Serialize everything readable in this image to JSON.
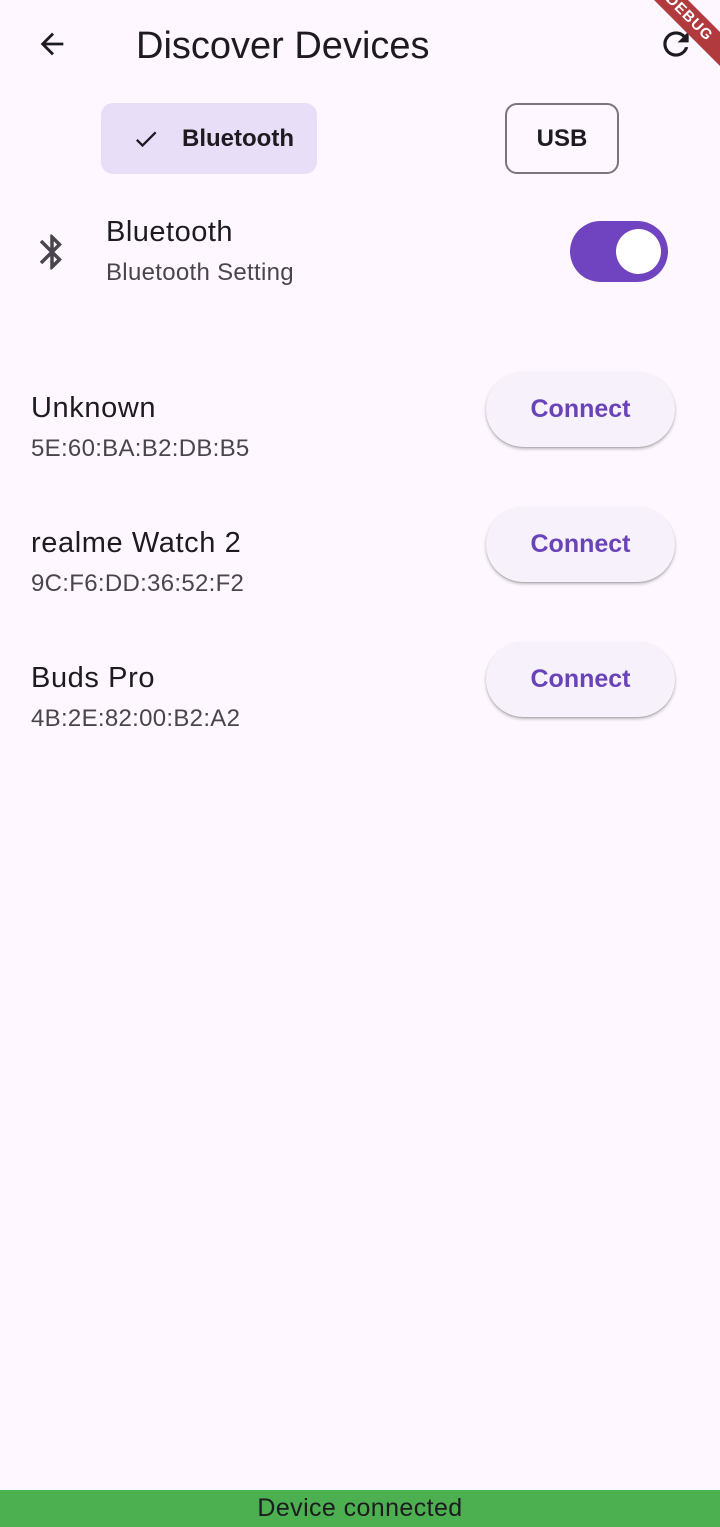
{
  "header": {
    "title": "Discover Devices",
    "back_icon": "arrow-back-icon",
    "refresh_icon": "refresh-icon"
  },
  "debug_banner": "DEBUG",
  "mode_chips": [
    {
      "label": "Bluetooth",
      "selected": true,
      "icon": "check-icon"
    },
    {
      "label": "USB",
      "selected": false
    }
  ],
  "bluetooth_setting": {
    "icon": "bluetooth-icon",
    "title": "Bluetooth",
    "subtitle": "Bluetooth Setting",
    "enabled": true
  },
  "devices": [
    {
      "name": "Unknown",
      "mac": "5E:60:BA:B2:DB:B5",
      "action": "Connect"
    },
    {
      "name": "realme Watch 2",
      "mac": "9C:F6:DD:36:52:F2",
      "action": "Connect"
    },
    {
      "name": "Buds Pro",
      "mac": "4B:2E:82:00:B2:A2",
      "action": "Connect"
    }
  ],
  "status": {
    "message": "Device connected",
    "color": "#4caf50"
  },
  "colors": {
    "accent": "#7043c0",
    "chip_selected_bg": "#e8def8",
    "background": "#fef7ff"
  }
}
